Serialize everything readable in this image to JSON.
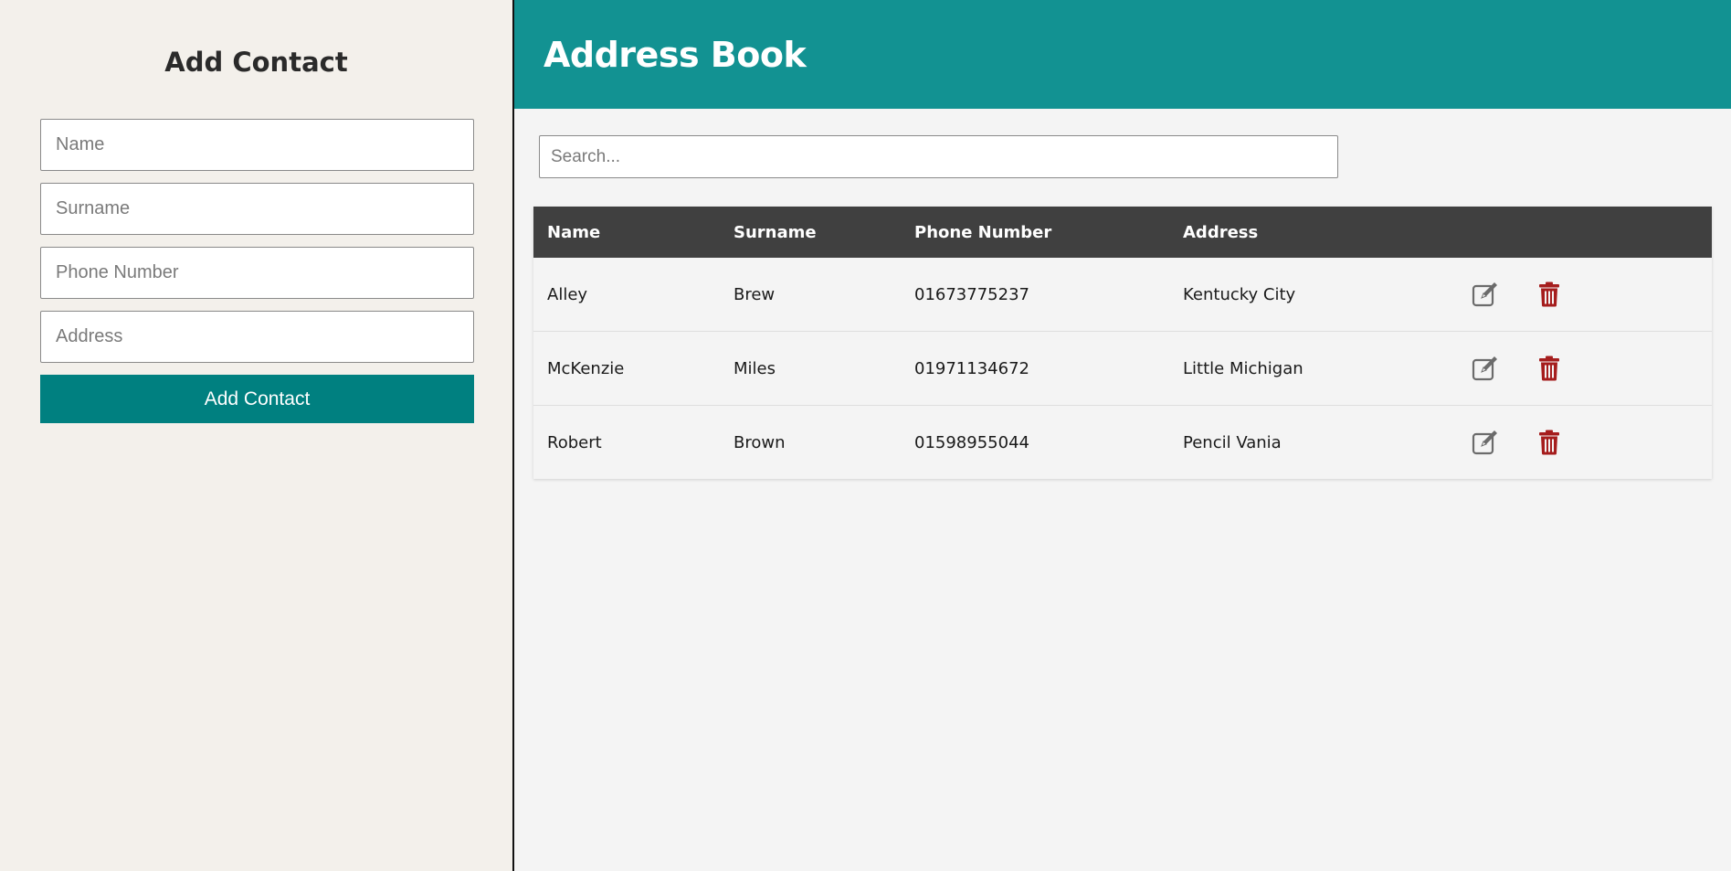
{
  "sidebar": {
    "title": "Add Contact",
    "fields": {
      "name_placeholder": "Name",
      "surname_placeholder": "Surname",
      "phone_placeholder": "Phone Number",
      "address_placeholder": "Address"
    },
    "submit_label": "Add Contact"
  },
  "header": {
    "title": "Address Book"
  },
  "search": {
    "placeholder": "Search..."
  },
  "table": {
    "columns": [
      "Name",
      "Surname",
      "Phone Number",
      "Address"
    ],
    "rows": [
      {
        "name": "Alley",
        "surname": "Brew",
        "phone": "01673775237",
        "address": "Kentucky City"
      },
      {
        "name": "McKenzie",
        "surname": "Miles",
        "phone": "01971134672",
        "address": "Little Michigan"
      },
      {
        "name": "Robert",
        "surname": "Brown",
        "phone": "01598955044",
        "address": "Pencil Vania"
      }
    ],
    "row_icons": {
      "edit": "edit-icon",
      "delete": "trash-icon"
    }
  },
  "colors": {
    "header_bg": "#129292",
    "button_bg": "#008080",
    "sidebar_bg": "#f3f0eb",
    "table_head_bg": "#404040",
    "delete_icon": "#a51d1d",
    "edit_icon": "#6b6b6b"
  }
}
